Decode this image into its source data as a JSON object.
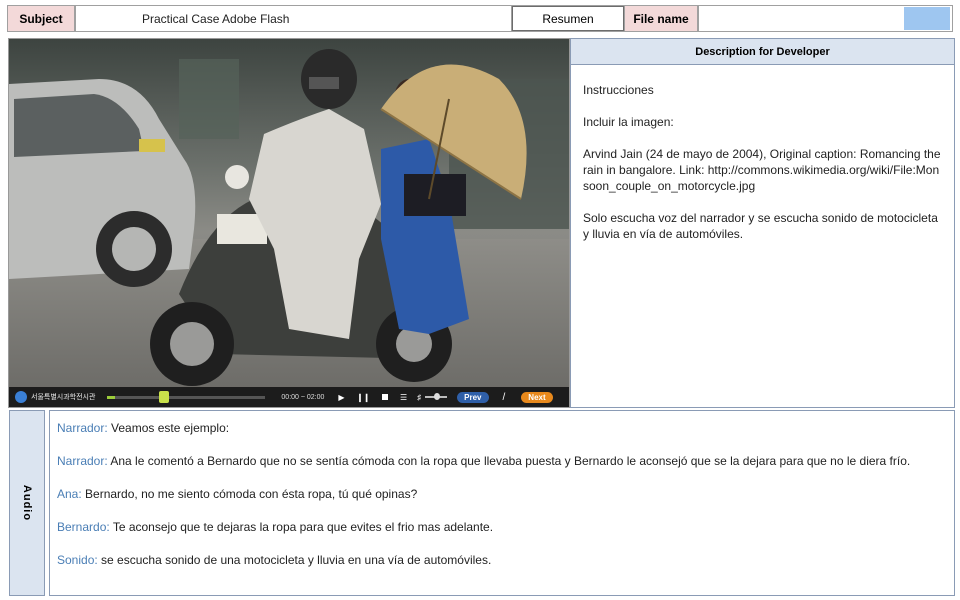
{
  "header": {
    "subject_label": "Subject",
    "subject_value": "Practical Case Adobe Flash",
    "resumen_label": "Resumen",
    "file_name_label": "File name",
    "file_name_value": ""
  },
  "player": {
    "brand": "서울특별시과학전시관",
    "time": "00:00 ~ 02:00",
    "prev_label": "Prev",
    "next_label": "Next",
    "progress_fraction": 0.05,
    "volume_fraction": 0.5
  },
  "description": {
    "title": "Description for Developer",
    "lines": [
      "Instrucciones",
      "Incluir la imagen:",
      "Arvind Jain (24 de mayo de 2004), Original caption: Romancing the rain in bangalore. Link: http://commons.wikimedia.org/wiki/File:Monsoon_couple_on_motorcycle.jpg",
      "Solo escucha voz del narrador  y se escucha sonido de motocicleta y lluvia en vía de automóviles."
    ]
  },
  "audio": {
    "tab_label": "Audio",
    "dialogue": [
      {
        "speaker": "Narrador:",
        "text": "Veamos este ejemplo:"
      },
      {
        "speaker": "Narrador:",
        "text": "Ana le comentó a Bernardo que no se sentía cómoda con la ropa que llevaba puesta y Bernardo le aconsejó que se la dejara para que no le diera frío."
      },
      {
        "speaker": "Ana:",
        "text": "Bernardo, no me siento cómoda con ésta ropa, tú qué opinas?"
      },
      {
        "speaker": "Bernardo:",
        "text": "Te aconsejo que te dejaras la ropa para que evites el frio mas adelante."
      },
      {
        "speaker": "Sonido:",
        "text": "se escucha sonido de una motocicleta y lluvia en una vía de automóviles."
      }
    ]
  },
  "colors": {
    "header_label_bg": "#f3d9d9",
    "panel_header_bg": "#dbe4f0",
    "speaker_color": "#4a7eb5",
    "file_swatch": "#9ec6f0",
    "next_button": "#e8891c",
    "prev_button": "#2f5fa8"
  }
}
